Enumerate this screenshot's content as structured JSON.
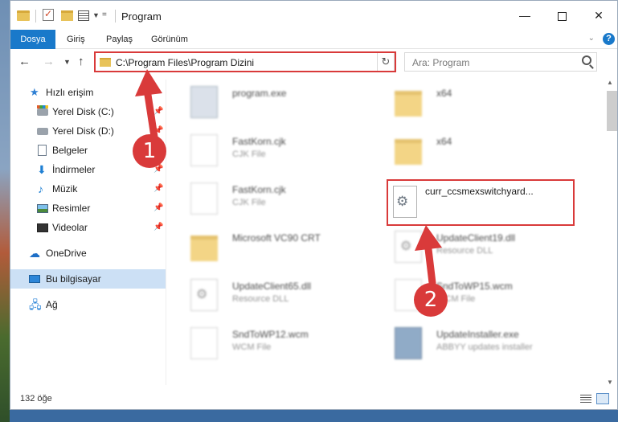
{
  "window": {
    "title": "Program"
  },
  "ribbon": {
    "tabs": [
      "Dosya",
      "Giriş",
      "Paylaş",
      "Görünüm"
    ],
    "help": "?"
  },
  "navbar": {
    "address": "C:\\Program Files\\Program Dizini",
    "search_placeholder": "Ara: Program"
  },
  "sidebar": {
    "items": [
      {
        "label": "Hızlı erişim",
        "icon": "star-icon",
        "pinned": false
      },
      {
        "label": "Yerel Disk (C:)",
        "icon": "drive-c-icon",
        "pinned": true
      },
      {
        "label": "Yerel Disk (D:)",
        "icon": "drive-d-icon",
        "pinned": true
      },
      {
        "label": "Belgeler",
        "icon": "documents-icon",
        "pinned": true
      },
      {
        "label": "İndirmeler",
        "icon": "downloads-icon",
        "pinned": true
      },
      {
        "label": "Müzik",
        "icon": "music-icon",
        "pinned": true
      },
      {
        "label": "Resimler",
        "icon": "pictures-icon",
        "pinned": true
      },
      {
        "label": "Videolar",
        "icon": "videos-icon",
        "pinned": true
      },
      {
        "label": "OneDrive",
        "icon": "onedrive-icon",
        "pinned": false
      },
      {
        "label": "Bu bilgisayar",
        "icon": "this-pc-icon",
        "pinned": false,
        "selected": true
      },
      {
        "label": "Ağ",
        "icon": "network-icon",
        "pinned": false
      }
    ]
  },
  "files": [
    {
      "name": "program.exe",
      "type": "",
      "icon": "exe-icon"
    },
    {
      "name": "x64",
      "type": "",
      "icon": "folder-icon"
    },
    {
      "name": "FastKorn.cjk",
      "type": "CJK File",
      "icon": "file-icon"
    },
    {
      "name": "x64",
      "type": "",
      "icon": "folder-icon"
    },
    {
      "name": "FastKorn.cjk",
      "type": "CJK File",
      "icon": "file-icon"
    },
    {
      "name": "Microsoft VC90 CRT",
      "type": "",
      "icon": "folder-icon"
    },
    {
      "name": "UpdateClient19.dll",
      "type": "Resource DLL",
      "icon": "dll-icon"
    },
    {
      "name": "UpdateClient65.dll",
      "type": "Resource DLL",
      "icon": "dll-icon"
    },
    {
      "name": "SndToWP15.wcm",
      "type": "WCM File",
      "icon": "file-icon"
    },
    {
      "name": "SndToWP12.wcm",
      "type": "WCM File",
      "icon": "file-icon"
    },
    {
      "name": "UpdateInstaller.exe",
      "type": "ABBYY updates installer",
      "icon": "installer-icon"
    }
  ],
  "selected_file": {
    "name": "curr_ccsmexswitchyard...",
    "icon": "dll-gear-icon"
  },
  "status": {
    "count": "132 öğe"
  },
  "callouts": [
    "1",
    "2"
  ]
}
